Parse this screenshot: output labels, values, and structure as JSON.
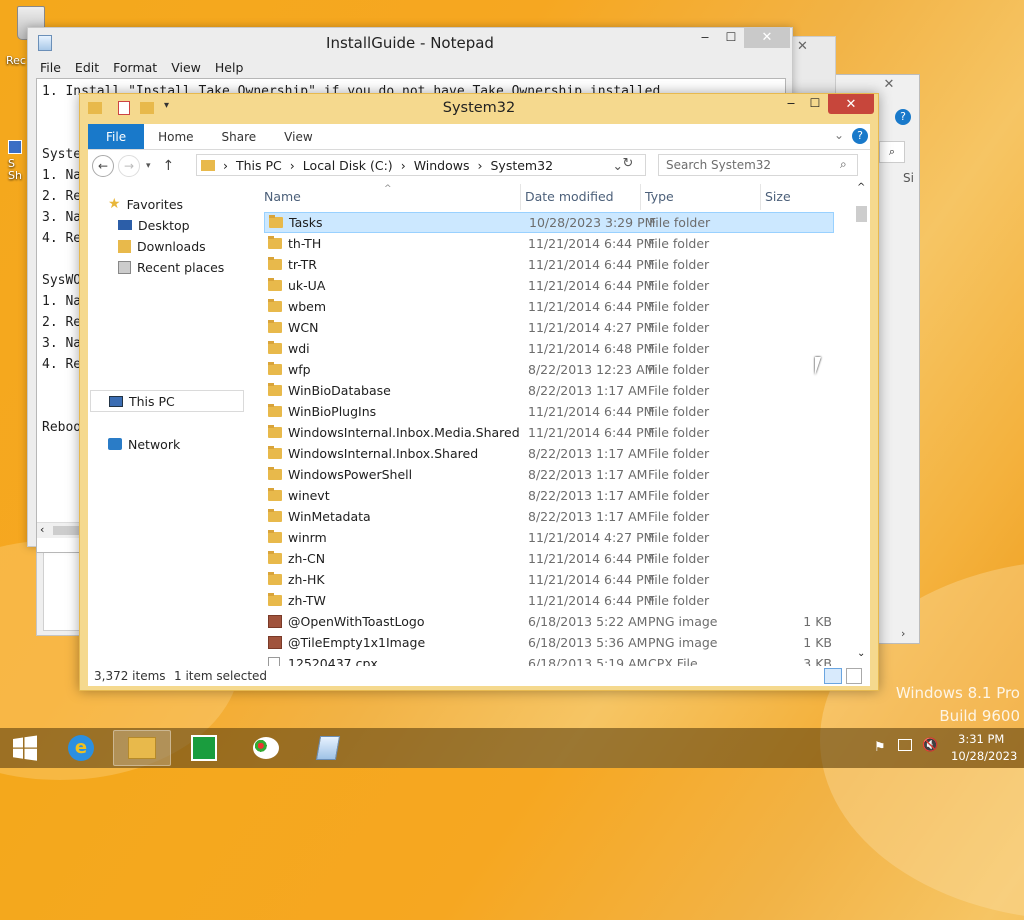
{
  "desktop": {
    "recycle_label": "Rec",
    "shortcut_label": "S\nSh"
  },
  "back_window": {
    "back_label": "Si"
  },
  "notepad": {
    "title": "InstallGuide - Notepad",
    "menus": [
      "File",
      "Edit",
      "Format",
      "View",
      "Help"
    ],
    "lines": [
      "1. Install \"Install Take Ownership\" if you do not have Take Ownership installed",
      "",
      "",
      "Syste",
      "1. Na",
      "2. Re",
      "3. Na",
      "4. Re",
      "",
      "SysWO",
      "1. Na",
      "2. Re",
      "3. Na",
      "4. Re",
      "",
      "",
      "Reboo"
    ]
  },
  "explorer": {
    "title": "System32",
    "ribbon_tabs": [
      "File",
      "Home",
      "Share",
      "View"
    ],
    "breadcrumb": [
      "This PC",
      "Local Disk (C:)",
      "Windows",
      "System32"
    ],
    "search_placeholder": "Search System32",
    "nav": {
      "favorites": "Favorites",
      "desktop": "Desktop",
      "downloads": "Downloads",
      "recent": "Recent places",
      "this_pc": "This PC",
      "network": "Network"
    },
    "columns": {
      "name": "Name",
      "date": "Date modified",
      "type": "Type",
      "size": "Size"
    },
    "files": [
      {
        "name": "Tasks",
        "date": "10/28/2023 3:29 PM",
        "type": "File folder",
        "size": "",
        "icon": "folder",
        "selected": true
      },
      {
        "name": "th-TH",
        "date": "11/21/2014 6:44 PM",
        "type": "File folder",
        "size": "",
        "icon": "folder"
      },
      {
        "name": "tr-TR",
        "date": "11/21/2014 6:44 PM",
        "type": "File folder",
        "size": "",
        "icon": "folder"
      },
      {
        "name": "uk-UA",
        "date": "11/21/2014 6:44 PM",
        "type": "File folder",
        "size": "",
        "icon": "folder"
      },
      {
        "name": "wbem",
        "date": "11/21/2014 6:44 PM",
        "type": "File folder",
        "size": "",
        "icon": "folder"
      },
      {
        "name": "WCN",
        "date": "11/21/2014 4:27 PM",
        "type": "File folder",
        "size": "",
        "icon": "folder"
      },
      {
        "name": "wdi",
        "date": "11/21/2014 6:48 PM",
        "type": "File folder",
        "size": "",
        "icon": "folder"
      },
      {
        "name": "wfp",
        "date": "8/22/2013 12:23 AM",
        "type": "File folder",
        "size": "",
        "icon": "folder"
      },
      {
        "name": "WinBioDatabase",
        "date": "8/22/2013 1:17 AM",
        "type": "File folder",
        "size": "",
        "icon": "folder"
      },
      {
        "name": "WinBioPlugIns",
        "date": "11/21/2014 6:44 PM",
        "type": "File folder",
        "size": "",
        "icon": "folder"
      },
      {
        "name": "WindowsInternal.Inbox.Media.Shared",
        "date": "11/21/2014 6:44 PM",
        "type": "File folder",
        "size": "",
        "icon": "folder"
      },
      {
        "name": "WindowsInternal.Inbox.Shared",
        "date": "8/22/2013 1:17 AM",
        "type": "File folder",
        "size": "",
        "icon": "folder"
      },
      {
        "name": "WindowsPowerShell",
        "date": "8/22/2013 1:17 AM",
        "type": "File folder",
        "size": "",
        "icon": "folder"
      },
      {
        "name": "winevt",
        "date": "8/22/2013 1:17 AM",
        "type": "File folder",
        "size": "",
        "icon": "folder"
      },
      {
        "name": "WinMetadata",
        "date": "8/22/2013 1:17 AM",
        "type": "File folder",
        "size": "",
        "icon": "folder"
      },
      {
        "name": "winrm",
        "date": "11/21/2014 4:27 PM",
        "type": "File folder",
        "size": "",
        "icon": "folder"
      },
      {
        "name": "zh-CN",
        "date": "11/21/2014 6:44 PM",
        "type": "File folder",
        "size": "",
        "icon": "folder"
      },
      {
        "name": "zh-HK",
        "date": "11/21/2014 6:44 PM",
        "type": "File folder",
        "size": "",
        "icon": "folder"
      },
      {
        "name": "zh-TW",
        "date": "11/21/2014 6:44 PM",
        "type": "File folder",
        "size": "",
        "icon": "folder"
      },
      {
        "name": "@OpenWithToastLogo",
        "date": "6/18/2013 5:22 AM",
        "type": "PNG image",
        "size": "1 KB",
        "icon": "png"
      },
      {
        "name": "@TileEmpty1x1Image",
        "date": "6/18/2013 5:36 AM",
        "type": "PNG image",
        "size": "1 KB",
        "icon": "png"
      },
      {
        "name": "12520437.cpx",
        "date": "6/18/2013 5:19 AM",
        "type": "CPX File",
        "size": "3 KB",
        "icon": "doc"
      }
    ],
    "status_items": "3,372 items",
    "status_selected": "1 item selected"
  },
  "watermark": {
    "line1": "Windows 8.1 Pro",
    "line2": "Build 9600"
  },
  "taskbar": {
    "time": "3:31 PM",
    "date": "10/28/2023"
  },
  "colors": {
    "accent": "#1979ca",
    "explorer_frame": "#f5d98e",
    "close": "#c7463b",
    "selection": "#cce8ff"
  }
}
